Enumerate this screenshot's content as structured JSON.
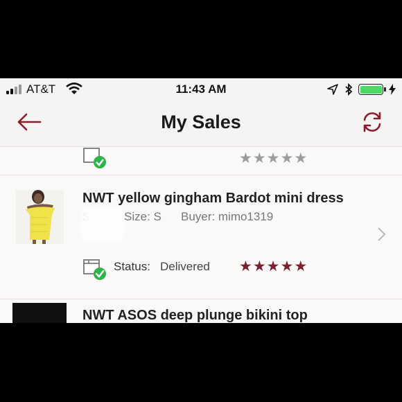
{
  "status_bar": {
    "carrier": "AT&T",
    "time": "11:43 AM",
    "battery_color": "#4cd964"
  },
  "nav": {
    "title": "My Sales",
    "back_icon": "arrow-left-icon",
    "refresh_icon": "refresh-icon",
    "accent_color": "#8b1c2b"
  },
  "sales": [
    {
      "title": "NWT yellow gingham Bardot mini dress",
      "price": "$",
      "size_label": "Size:",
      "size": "S",
      "buyer_label": "Buyer:",
      "buyer": "mimo1319",
      "status_label": "Status:",
      "status": "Delivered",
      "rating": 5
    },
    {
      "title": "NWT ASOS deep plunge bikini top"
    }
  ]
}
